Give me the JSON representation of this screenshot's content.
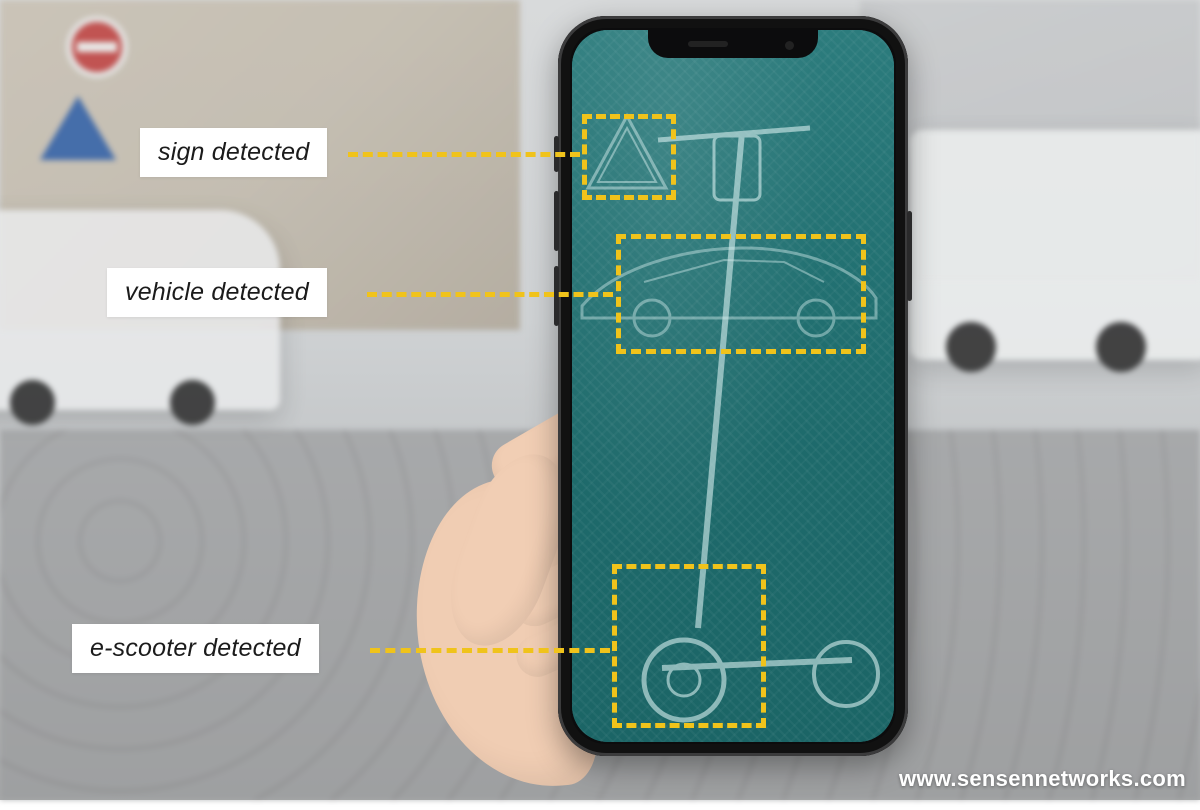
{
  "labels": {
    "sign": "sign detected",
    "vehicle": "vehicle detected",
    "escooter": "e-scooter detected"
  },
  "watermark": "www.sensennetworks.com",
  "colors": {
    "detect_box": "#f0c31b",
    "screen_teal": "#237273",
    "label_bg": "#ffffff",
    "label_text": "#1b1b1b"
  },
  "detections": [
    {
      "name": "sign",
      "label_key": "labels.sign"
    },
    {
      "name": "vehicle",
      "label_key": "labels.vehicle"
    },
    {
      "name": "escooter",
      "label_key": "labels.escooter"
    }
  ]
}
